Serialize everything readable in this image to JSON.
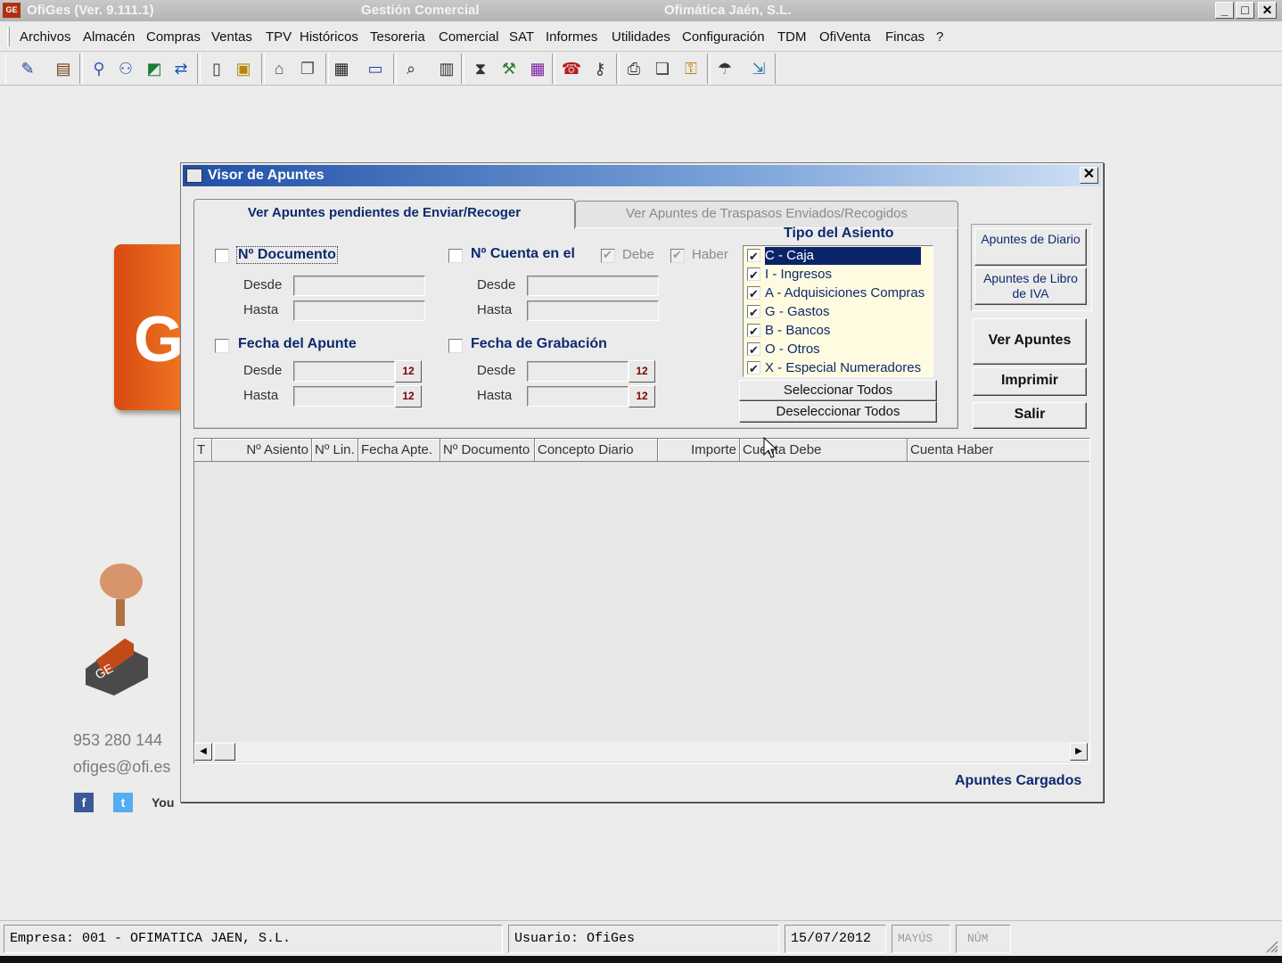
{
  "window": {
    "icon_text": "GE",
    "title": "OfiGes (Ver. 9.111.1)",
    "subtitle": "Gestión Comercial",
    "company": "Ofimática Jaén, S.L.",
    "minimize": "_",
    "maximize": "□",
    "close": "✕"
  },
  "menu": [
    "Archivos",
    "Almacén",
    "Compras",
    "Ventas",
    "TPV",
    "Históricos",
    "Tesoreria",
    "Comercial",
    "SAT",
    "Informes",
    "Utilidades",
    "Configuración",
    "TDM",
    "OfiVenta",
    "Fincas",
    "?"
  ],
  "toolbar_icons": [
    "edit-document-icon",
    "books-icon",
    "people-icon",
    "people-group-icon",
    "chart-icon",
    "transfer-arrows-icon",
    "clipboard-icon",
    "folders-icon",
    "cash-drawer-icon",
    "boxes-icon",
    "register-icon",
    "card-icon",
    "search-document-icon",
    "invoice-icon",
    "hourglass-icon",
    "tools-icon",
    "calendar-icon",
    "phone-icon",
    "key-search-icon",
    "printer-icon",
    "copy-icon",
    "keys-icon",
    "umbrella-icon",
    "exit-door-icon"
  ],
  "background": {
    "logo_letter": "G",
    "phone": "953 280 144",
    "email": "ofiges@ofi.es",
    "social": [
      "f",
      "t",
      "You"
    ]
  },
  "dialog": {
    "title": "Visor de Apuntes",
    "close": "✕",
    "tabs": {
      "pending": "Ver Apuntes pendientes de Enviar/Recoger",
      "sent": "Ver Apuntes de Traspasos Enviados/Recogidos"
    },
    "filters": {
      "doc_label": "Nº Documento",
      "account_label": "Nº Cuenta en el",
      "debe": "Debe",
      "haber": "Haber",
      "fecha_apunte": "Fecha del Apunte",
      "fecha_grabacion": "Fecha de Grabación",
      "desde": "Desde",
      "hasta": "Hasta",
      "cal_glyph": "12"
    },
    "tipo": {
      "title": "Tipo del Asiento",
      "items": [
        {
          "label": "C - Caja",
          "checked": true
        },
        {
          "label": "I - Ingresos",
          "checked": true
        },
        {
          "label": "A - Adquisiciones Compras",
          "checked": true
        },
        {
          "label": "G - Gastos",
          "checked": true
        },
        {
          "label": "B - Bancos",
          "checked": true
        },
        {
          "label": "O - Otros",
          "checked": true
        },
        {
          "label": "X - Especial Numeradores",
          "checked": true
        }
      ],
      "select_all": "Seleccionar Todos",
      "deselect_all": "Deseleccionar Todos"
    },
    "buttons": {
      "apuntes_diario": "Apuntes de Diario",
      "apuntes_iva": "Apuntes de Libro de IVA",
      "ver_apuntes": "Ver Apuntes",
      "imprimir": "Imprimir",
      "salir": "Salir"
    },
    "grid": {
      "columns": [
        "T",
        "Nº Asiento",
        "Nº Lin.",
        "Fecha Apte.",
        "Nº Documento",
        "Concepto Diario",
        "Importe",
        "Cuenta Debe",
        "Cuenta Haber"
      ],
      "rows": []
    },
    "status": "Apuntes Cargados"
  },
  "statusbar": {
    "empresa": "Empresa: 001 - OFIMATICA JAEN, S.L.",
    "usuario": "Usuario: OfiGes",
    "date": "15/07/2012",
    "mayus": "MAYÚS",
    "num": "NÚM"
  }
}
